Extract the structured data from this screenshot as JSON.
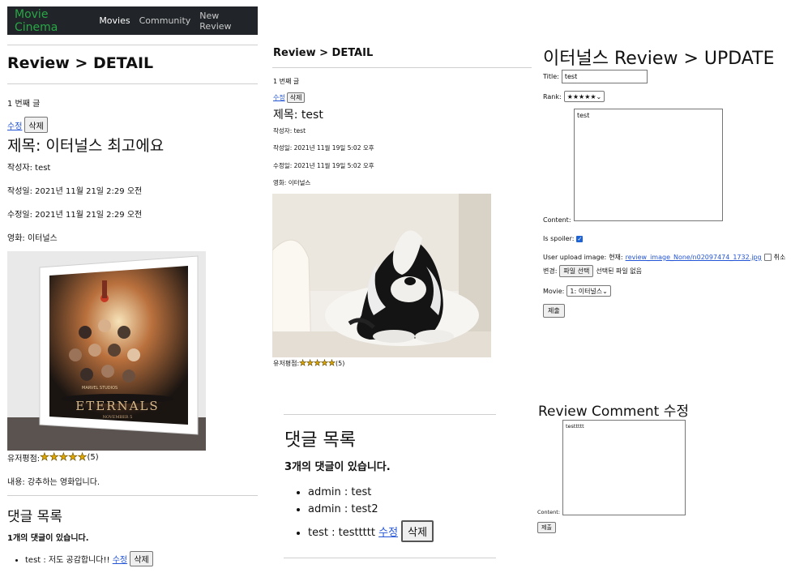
{
  "nav": {
    "brand": "Movie Cinema",
    "items": [
      "Movies",
      "Community",
      "New Review"
    ]
  },
  "detail_main": {
    "heading": "Review > DETAIL",
    "post_number": "1 번째 글",
    "edit_link": "수정",
    "delete_button": "삭제",
    "title": "제목: 이터널스 최고에요",
    "author": "작성자: test",
    "created": "작성일: 2021년 11월 21일 2:29 오전",
    "updated": "수정일: 2021년 11월 21일 2:29 오전",
    "movie": "영화: 이터널스",
    "poster_text": {
      "studio": "MARVEL STUDIOS",
      "title": "ETERNALS",
      "date": "NOVEMBER 5"
    },
    "rating_label": "유저평점:",
    "rating_stars": 5,
    "rating_value": "(5)",
    "content": "내용: 강추하는 영화입니다.",
    "comments_heading": "댓글 목록",
    "comments_count": "1개의 댓글이 있습니다.",
    "comments": [
      {
        "text": "test : 저도 공감합니다!!",
        "edit": "수정",
        "delete": "삭제"
      }
    ]
  },
  "detail_second": {
    "heading": "Review > DETAIL",
    "post_number": "1 번째 글",
    "edit_link": "수정",
    "delete_button": "삭제",
    "title": "제목: test",
    "author": "작성자: test",
    "created": "작성일: 2021년 11월 19일 5:02 오후",
    "updated": "수정일: 2021년 11월 19일 5:02 오후",
    "movie": "영화: 이터널스",
    "rating_label": "유저평점:",
    "rating_stars": 5,
    "rating_value": "(5)",
    "comments_heading": "댓글 목록",
    "comments_count": "3개의 댓글이 있습니다.",
    "comments": [
      {
        "text": "admin : test"
      },
      {
        "text": "admin : test2"
      },
      {
        "text": "test : testtttt",
        "edit": "수정",
        "delete": "삭제"
      }
    ]
  },
  "update_form": {
    "heading": "이터널스 Review > UPDATE",
    "title_label": "Title:",
    "title_value": "test",
    "rank_label": "Rank:",
    "rank_value": "★★★★★",
    "content_label": "Content:",
    "content_value": "test",
    "spoiler_label": "Is spoiler:",
    "spoiler_checked": true,
    "image_label": "User upload image:",
    "image_current_label": "현재:",
    "image_link": "review_image_None/n02097474_1732.jpg",
    "image_clear_label": "취소",
    "image_change_label": "변경:",
    "file_button": "파일 선택",
    "file_none": "선택된 파일 없음",
    "movie_label": "Movie:",
    "movie_value": "1: 이터널스",
    "submit": "제출"
  },
  "comment_edit": {
    "heading": "Review Comment 수정",
    "content_label": "Content:",
    "content_value": "testtttt",
    "submit": "제출"
  }
}
